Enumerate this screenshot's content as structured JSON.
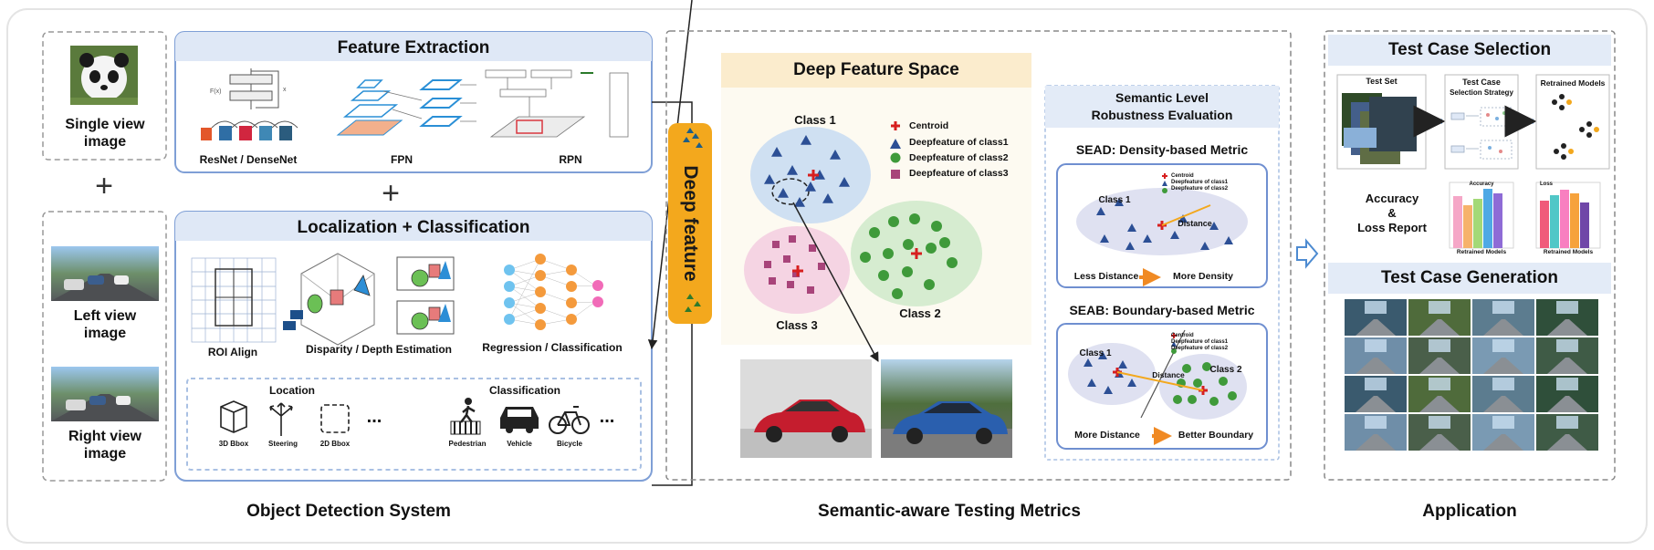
{
  "inputs": {
    "single_view": "Single view image",
    "left_view": "Left view image",
    "right_view": "Right view image",
    "plus": "+"
  },
  "feature_extraction": {
    "title": "Feature Extraction",
    "resnet": "ResNet / DenseNet",
    "fpn": "FPN",
    "rpn": "RPN"
  },
  "localization": {
    "title": "Localization + Classification",
    "roi": "ROI Align",
    "disparity": "Disparity / Depth Estimation",
    "regression": "Regression / Classification",
    "location_title": "Location",
    "classification_title": "Classification",
    "location_items": [
      "3D Bbox",
      "Steering",
      "2D Bbox"
    ],
    "class_items": [
      "Pedestrian",
      "Vehicle",
      "Bicycle"
    ],
    "ellipsis": "..."
  },
  "deep_feature": {
    "label": "Deep feature"
  },
  "deep_space": {
    "title": "Deep Feature Space",
    "class1": "Class 1",
    "class2": "Class 2",
    "class3": "Class 3",
    "legend": [
      "Centroid",
      "Deepfeature of class1",
      "Deepfeature of class2",
      "Deepfeature of class3"
    ]
  },
  "semantic_eval": {
    "title_line1": "Semantic Level",
    "title_line2": "Robustness Evaluation",
    "sead_title": "SEAD: Density-based Metric",
    "sead_less": "Less Distance",
    "sead_more": "More Density",
    "seab_title": "SEAB: Boundary-based Metric",
    "seab_more": "More Distance",
    "seab_better": "Better Boundary",
    "mini_legend": [
      "Centroid",
      "Deepfeature of class1",
      "Deepfeature of class2"
    ],
    "class1": "Class 1",
    "class2": "Class 2",
    "distance": "Distance"
  },
  "application": {
    "selection_title": "Test Case Selection",
    "test_set": "Test Set",
    "strategy_line1": "Test Case",
    "strategy_line2": "Selection Strategy",
    "retrained": "Retrained Models",
    "report_line1": "Accuracy",
    "report_line2": "&",
    "report_line3": "Loss Report",
    "acc_chart_title": "Accuracy",
    "loss_chart_title": "Loss",
    "chart_xlabel": "Retrained Models",
    "generation_title": "Test Case Generation"
  },
  "footer": {
    "ods": "Object Detection System",
    "stm": "Semantic-aware Testing Metrics",
    "app": "Application"
  },
  "colors": {
    "panel_border": "#7f9fd6",
    "panel_header": "#dfe8f6",
    "deep_feature": "#f3a81d",
    "class1_fill": "#cfe0f2",
    "class2_fill": "#d6ecd0",
    "class3_fill": "#f5d4e3",
    "triangle": "#2c4f95",
    "circle": "#3f9a3a",
    "square": "#a8447a",
    "centroid": "#d71f1f",
    "arrow_orange": "#f08a24"
  }
}
